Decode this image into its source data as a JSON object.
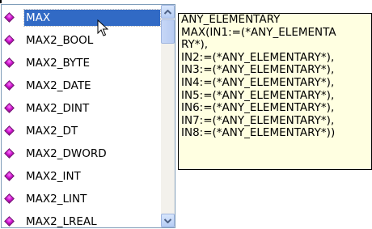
{
  "list": {
    "items": [
      {
        "label": "MAX",
        "selected": true
      },
      {
        "label": "MAX2_BOOL",
        "selected": false
      },
      {
        "label": "MAX2_BYTE",
        "selected": false
      },
      {
        "label": "MAX2_DATE",
        "selected": false
      },
      {
        "label": "MAX2_DINT",
        "selected": false
      },
      {
        "label": "MAX2_DT",
        "selected": false
      },
      {
        "label": "MAX2_DWORD",
        "selected": false
      },
      {
        "label": "MAX2_INT",
        "selected": false
      },
      {
        "label": "MAX2_LINT",
        "selected": false
      },
      {
        "label": "MAX2_LREAL",
        "selected": false
      }
    ],
    "item_icon": "function-block-diamond-icon",
    "selection_color": "#316ac5"
  },
  "scrollbar": {
    "up_icon": "chevron-up-icon",
    "down_icon": "chevron-down-icon"
  },
  "tooltip": {
    "lines": [
      "ANY_ELEMENTARY",
      "MAX(IN1:=(*ANY_ELEMENTA",
      "RY*),",
      "IN2:=(*ANY_ELEMENTARY*),",
      "IN3:=(*ANY_ELEMENTARY*),",
      "IN4:=(*ANY_ELEMENTARY*),",
      "IN5:=(*ANY_ELEMENTARY*),",
      "IN6:=(*ANY_ELEMENTARY*),",
      "IN7:=(*ANY_ELEMENTARY*),",
      "IN8:=(*ANY_ELEMENTARY*))"
    ],
    "background": "#ffffe1"
  }
}
